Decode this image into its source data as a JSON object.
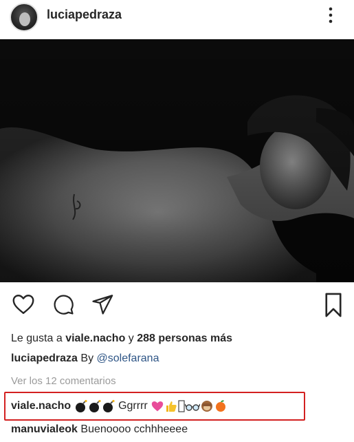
{
  "post": {
    "username": "luciapedraza",
    "more_icon": "more-vertical-icon"
  },
  "actions": {
    "like_icon": "heart-icon",
    "comment_icon": "comment-icon",
    "share_icon": "send-icon",
    "save_icon": "bookmark-icon"
  },
  "likes": {
    "prefix": "Le gusta a",
    "user": "viale.nacho",
    "connector": "y",
    "count_text": "288 personas más"
  },
  "caption": {
    "username": "luciapedraza",
    "text": "By",
    "mention": "@solefarana"
  },
  "comments": {
    "view_all": "Ver los 12 comentarios",
    "items": [
      {
        "username": "viale.nacho",
        "text": "Ggrrrr",
        "emojis_before": [
          "bomb-icon",
          "bomb-icon",
          "bomb-icon"
        ],
        "emojis_after": [
          "pink-heart-icon",
          "thumbs-up-icon",
          "missing-glyph-icon",
          "glasses-icon",
          "see-no-evil-monkey-icon",
          "peach-icon"
        ]
      },
      {
        "username": "manuvialeok",
        "text": "Buenoooo cchhheeee"
      }
    ]
  },
  "colors": {
    "text": "#262626",
    "muted": "#9a9a9a",
    "link": "#2e5586",
    "highlight_border": "#d32020"
  }
}
